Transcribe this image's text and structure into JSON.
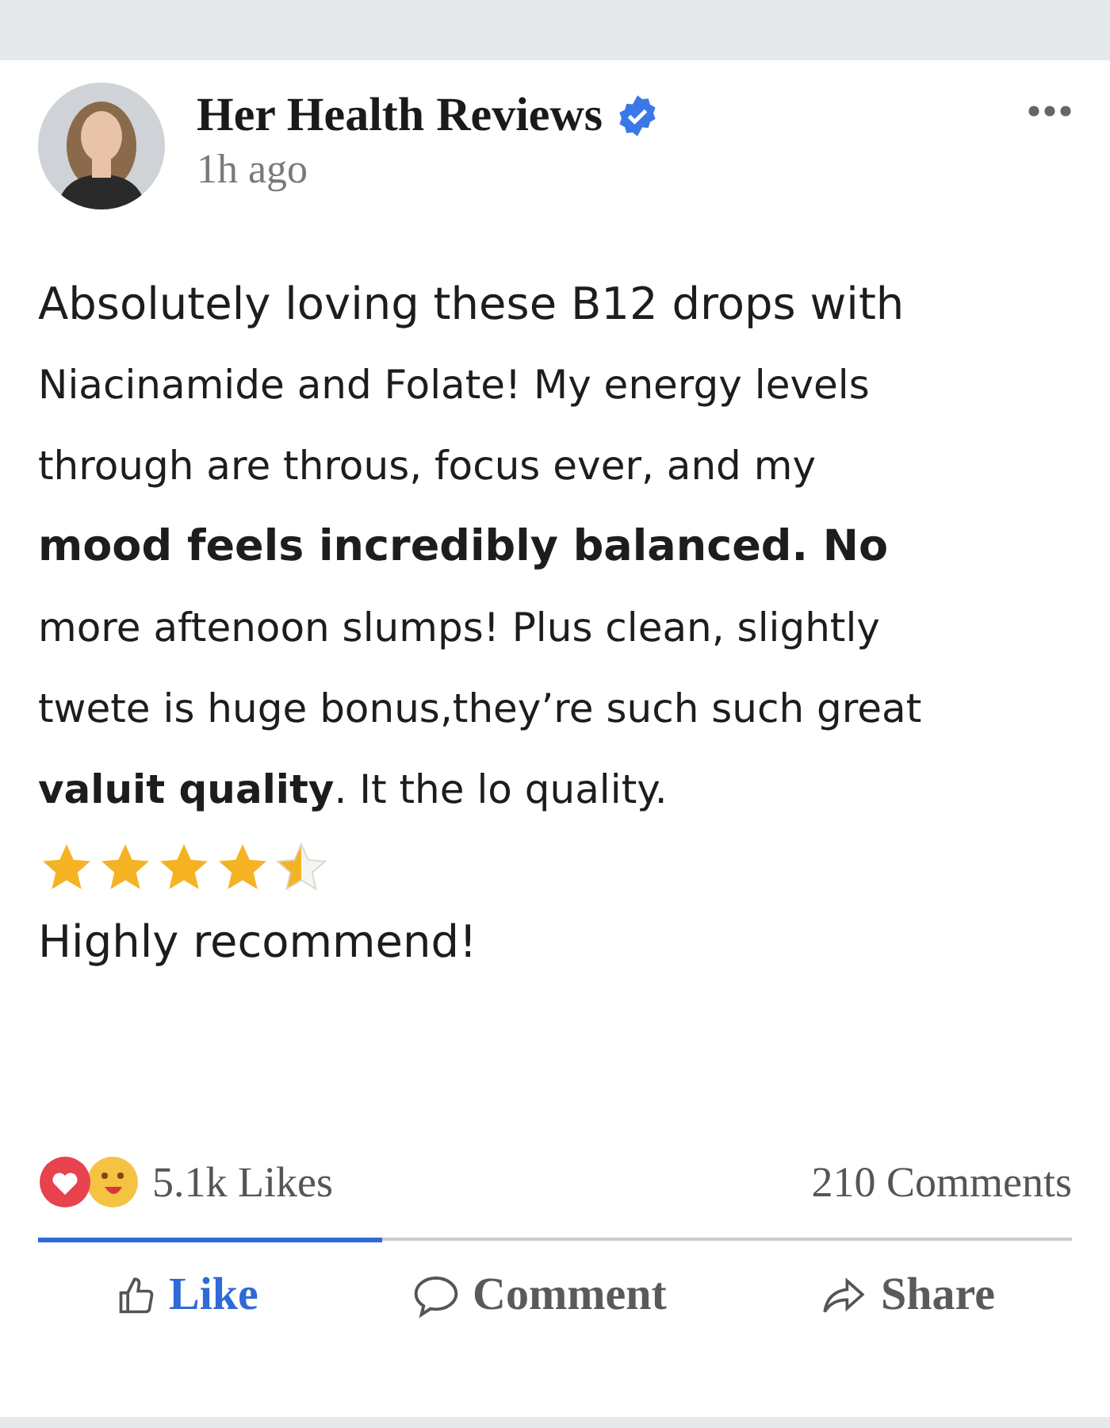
{
  "post": {
    "author": "Her Health Reviews",
    "verified": true,
    "time": "1h ago",
    "lines": [
      {
        "kind": "lead",
        "text": "Absolutely loving these B12 drops with"
      },
      {
        "kind": "body",
        "text": "Niacinamide and Folate! My energy levels"
      },
      {
        "kind": "body",
        "text": "through are throus, focus ever, and my"
      },
      {
        "kind": "strong",
        "text": "mood feels incredibly balanced. No"
      },
      {
        "kind": "body",
        "text": "more aftenoon slumps! Plus clean, slightly"
      },
      {
        "kind": "body",
        "text": "twete is huge bonus,they’re such such great"
      },
      {
        "kind": "body",
        "text": "**valuit quality**. It the lo quality."
      }
    ],
    "stars": 4.5,
    "closing": "Highly recommend!",
    "likes": "5.1k Likes",
    "comments": "210 Comments",
    "actions": [
      {
        "kind": "like",
        "label": "Like",
        "selected": true
      },
      {
        "kind": "comment",
        "label": "Comment",
        "selected": false
      },
      {
        "kind": "share",
        "label": "Share",
        "selected": false
      }
    ]
  }
}
